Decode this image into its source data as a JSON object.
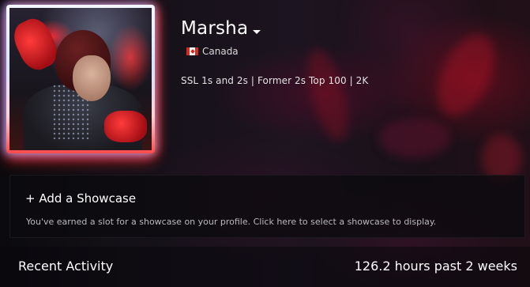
{
  "profile": {
    "name": "Marsha",
    "country": "Canada",
    "summary": "SSL 1s and 2s | Former 2s Top 100 | 2K"
  },
  "showcase": {
    "title": "+ Add a Showcase",
    "description": "You've earned a slot for a showcase on your profile. Click here to select a showcase to display."
  },
  "activity": {
    "title": "Recent Activity",
    "hours": "126.2 hours past 2 weeks"
  },
  "icons": {
    "persona_dropdown": "chevron-down-icon",
    "country_flag": "canada-flag-icon"
  },
  "colors": {
    "accent_red": "#d52b1e",
    "text_primary": "#ffffff",
    "text_secondary": "#b9b9b9"
  }
}
